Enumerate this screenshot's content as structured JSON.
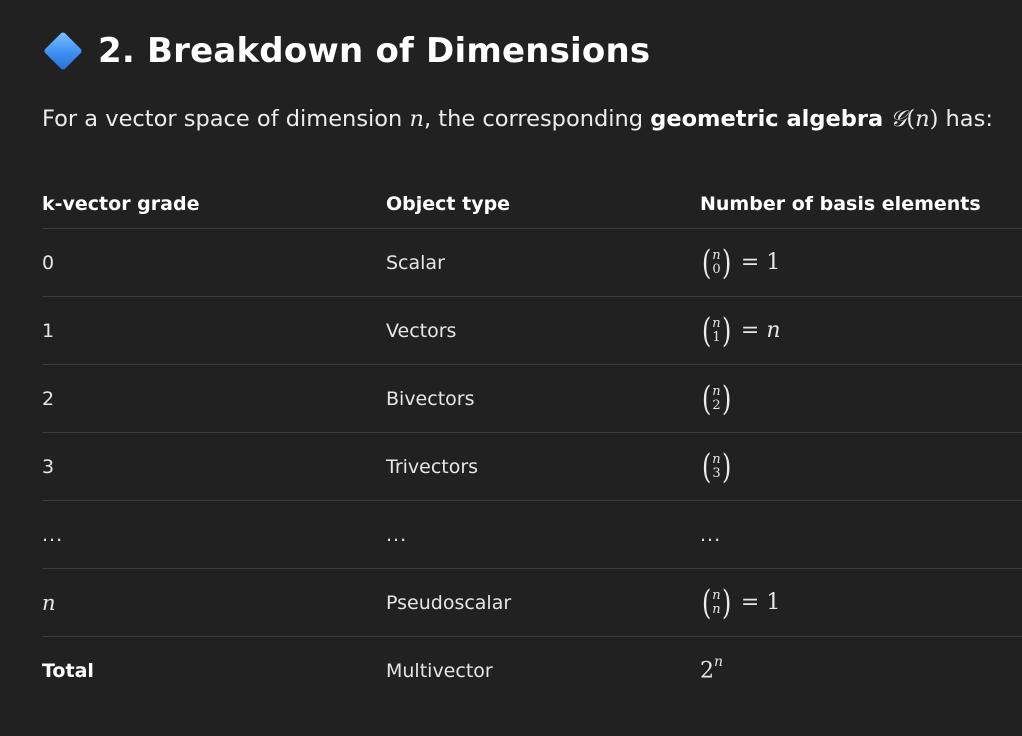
{
  "heading": {
    "icon": "blue-diamond-icon",
    "title": "2. Breakdown of Dimensions"
  },
  "intro": {
    "before": "For a vector space of dimension ",
    "n": "n",
    "middle": ", the corresponding ",
    "bold": "geometric algebra",
    "algebra_symbol": "𝒢",
    "algebra_open": "(",
    "algebra_n": "n",
    "algebra_close": ")",
    "after": " has:"
  },
  "table": {
    "headers": [
      "k-vector grade",
      "Object type",
      "Number of basis elements"
    ],
    "rows": [
      {
        "grade": "0",
        "type": "Scalar",
        "binom_top": "n",
        "binom_bot": "0",
        "eq": "= 1"
      },
      {
        "grade": "1",
        "type": "Vectors",
        "binom_top": "n",
        "binom_bot": "1",
        "eq": "= n"
      },
      {
        "grade": "2",
        "type": "Bivectors",
        "binom_top": "n",
        "binom_bot": "2",
        "eq": ""
      },
      {
        "grade": "3",
        "type": "Trivectors",
        "binom_top": "n",
        "binom_bot": "3",
        "eq": ""
      },
      {
        "grade": "...",
        "type": "...",
        "count": "..."
      },
      {
        "grade": "n",
        "type": "Pseudoscalar",
        "binom_top": "n",
        "binom_bot": "n",
        "eq": "= 1"
      },
      {
        "grade": "Total",
        "type": "Multivector",
        "base": "2",
        "exp": "n"
      }
    ]
  }
}
